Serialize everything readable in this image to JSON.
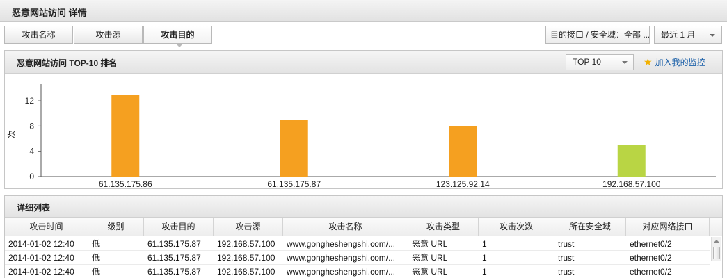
{
  "page": {
    "title": "恶意网站访问 详情"
  },
  "tabs": [
    {
      "label": "攻击名称",
      "active": false
    },
    {
      "label": "攻击源",
      "active": false
    },
    {
      "label": "攻击目的",
      "active": true
    }
  ],
  "filters": {
    "interface": "目的接口 / 安全域：全部 ...",
    "period": "最近 1 月"
  },
  "ranking": {
    "title": "恶意网站访问 TOP-10 排名",
    "top_select": "TOP 10",
    "add_monitor": "加入我的监控",
    "icon": "star-icon"
  },
  "chart_data": {
    "type": "bar",
    "categories": [
      "61.135.175.86",
      "61.135.175.87",
      "123.125.92.14",
      "192.168.57.100"
    ],
    "values": [
      13,
      9,
      8,
      5
    ],
    "colors": [
      "#f5a020",
      "#f5a020",
      "#f5a020",
      "#b9d544"
    ],
    "ylabel": "次",
    "ylim": [
      0,
      14
    ],
    "yticks": [
      0,
      4,
      8,
      12
    ],
    "grid": false
  },
  "detail": {
    "title": "详细列表",
    "columns": [
      "攻击时间",
      "级别",
      "攻击目的",
      "攻击源",
      "攻击名称",
      "攻击类型",
      "攻击次数",
      "所在安全域",
      "对应网络接口"
    ],
    "rows": [
      [
        "2014-01-02 12:40",
        "低",
        "61.135.175.87",
        "192.168.57.100",
        "www.gonghesheng​shi.com/...",
        "恶意 URL",
        "1",
        "trust",
        "ethernet0/2"
      ],
      [
        "2014-01-02 12:40",
        "低",
        "61.135.175.87",
        "192.168.57.100",
        "www.gonghesheng​shi.com/...",
        "恶意 URL",
        "1",
        "trust",
        "ethernet0/2"
      ],
      [
        "2014-01-02 12:40",
        "低",
        "61.135.175.87",
        "192.168.57.100",
        "www.gonghesheng​shi.com/...",
        "恶意 URL",
        "1",
        "trust",
        "ethernet0/2"
      ]
    ]
  }
}
